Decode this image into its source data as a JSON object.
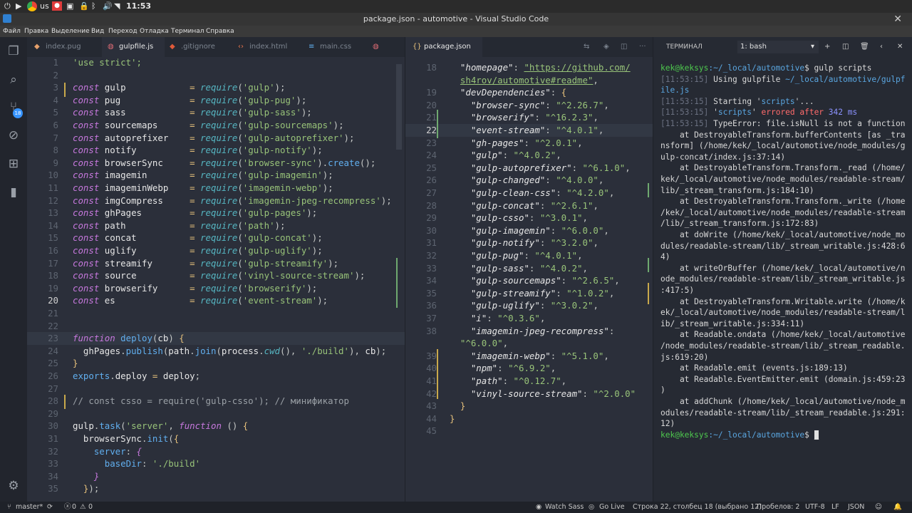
{
  "topbar": {
    "lang": "us",
    "time": "11:53"
  },
  "window": {
    "title": "package.json - automotive - Visual Studio Code"
  },
  "menu": [
    "Файл",
    "Правка",
    "Выделение",
    "Вид",
    "Переход",
    "Отладка",
    "Терминал",
    "Справка"
  ],
  "activity": {
    "badge": "18"
  },
  "editor1": {
    "tabs": [
      "index.pug",
      "gulpfile.js",
      ".gitignore",
      "index.html",
      "main.css"
    ],
    "active_tab": "gulpfile.js",
    "lines": [
      {
        "n": "1"
      },
      {
        "n": "2"
      },
      {
        "n": "3"
      },
      {
        "n": "4"
      },
      {
        "n": "5"
      },
      {
        "n": "6"
      },
      {
        "n": "7"
      },
      {
        "n": "8"
      },
      {
        "n": "9"
      },
      {
        "n": "10"
      },
      {
        "n": "11"
      },
      {
        "n": "12"
      },
      {
        "n": "13"
      },
      {
        "n": "14"
      },
      {
        "n": "15"
      },
      {
        "n": "16"
      },
      {
        "n": "17"
      },
      {
        "n": "18"
      },
      {
        "n": "19"
      },
      {
        "n": "20"
      },
      {
        "n": "21"
      },
      {
        "n": "22"
      },
      {
        "n": "23"
      },
      {
        "n": "24"
      },
      {
        "n": "25"
      },
      {
        "n": "26"
      },
      {
        "n": "27"
      },
      {
        "n": "28"
      },
      {
        "n": "29"
      },
      {
        "n": "30"
      },
      {
        "n": "31"
      },
      {
        "n": "32"
      },
      {
        "n": "33"
      },
      {
        "n": "34"
      },
      {
        "n": "35"
      }
    ],
    "requires": [
      [
        "gulp",
        "gulp"
      ],
      [
        "pug",
        "gulp-pug"
      ],
      [
        "sass",
        "gulp-sass"
      ],
      [
        "sourcemaps",
        "gulp-sourcemaps"
      ],
      [
        "autoprefixer",
        "gulp-autoprefixer"
      ],
      [
        "notify",
        "gulp-notify"
      ],
      [
        "browserSync",
        "browser-sync"
      ],
      [
        "imagemin",
        "gulp-imagemin"
      ],
      [
        "imageminWebp",
        "imagemin-webp"
      ],
      [
        "imgCompress",
        "imagemin-jpeg-recompress"
      ],
      [
        "ghPages",
        "gulp-pages"
      ],
      [
        "path",
        "path"
      ],
      [
        "concat",
        "gulp-concat"
      ],
      [
        "uglify",
        "gulp-uglify"
      ],
      [
        "streamify",
        "gulp-streamify"
      ],
      [
        "source",
        "vinyl-source-stream"
      ],
      [
        "browserify",
        "browserify"
      ],
      [
        "es",
        "event-stream"
      ]
    ],
    "strict": "'use strict';",
    "comment": "// const csso = require('gulp-csso'); // минификатор"
  },
  "editor2": {
    "tab": "package.json",
    "homepage_url": "\"https://github.com/sh4rov/automotive#readme\"",
    "deps": [
      [
        "browser-sync",
        "^2.26.7"
      ],
      [
        "browserify",
        "^16.2.3"
      ],
      [
        "event-stream",
        "^4.0.1"
      ],
      [
        "gh-pages",
        "^2.0.1"
      ],
      [
        "gulp",
        "^4.0.2"
      ],
      [
        "gulp-autoprefixer",
        "^6.1.0"
      ],
      [
        "gulp-changed",
        "^4.0.0"
      ],
      [
        "gulp-clean-css",
        "^4.2.0"
      ],
      [
        "gulp-concat",
        "^2.6.1"
      ],
      [
        "gulp-csso",
        "^3.0.1"
      ],
      [
        "gulp-imagemin",
        "^6.0.0"
      ],
      [
        "gulp-notify",
        "^3.2.0"
      ],
      [
        "gulp-pug",
        "^4.0.1"
      ],
      [
        "gulp-sass",
        "^4.0.2"
      ],
      [
        "gulp-sourcemaps",
        "^2.6.5"
      ],
      [
        "gulp-streamify",
        "^1.0.2"
      ],
      [
        "gulp-uglify",
        "^3.0.2"
      ],
      [
        "i",
        "^0.3.6"
      ],
      [
        "imagemin-jpeg-recompress",
        "^6.0.0"
      ],
      [
        "imagemin-webp",
        "^5.1.0"
      ],
      [
        "npm",
        "^6.9.2"
      ],
      [
        "path",
        "^0.12.7"
      ],
      [
        "vinyl-source-stream",
        "^2.0.0"
      ]
    ]
  },
  "terminal": {
    "title": "ТЕРМИНАЛ",
    "shell": "1: bash",
    "prompt": "kek@keksys",
    "path": ":~/_local/automotive",
    "cmd": "$ gulp scripts",
    "ts": "[11:53:15]"
  },
  "status": {
    "branch": "master*",
    "errors": "0",
    "warnings": "0",
    "watch": "Watch Sass",
    "golive": "Go Live",
    "position": "Строка 22, столбец 18 (выбрано 12)",
    "spaces": "Пробелов: 2",
    "encoding": "UTF-8",
    "eol": "LF",
    "lang": "JSON"
  }
}
